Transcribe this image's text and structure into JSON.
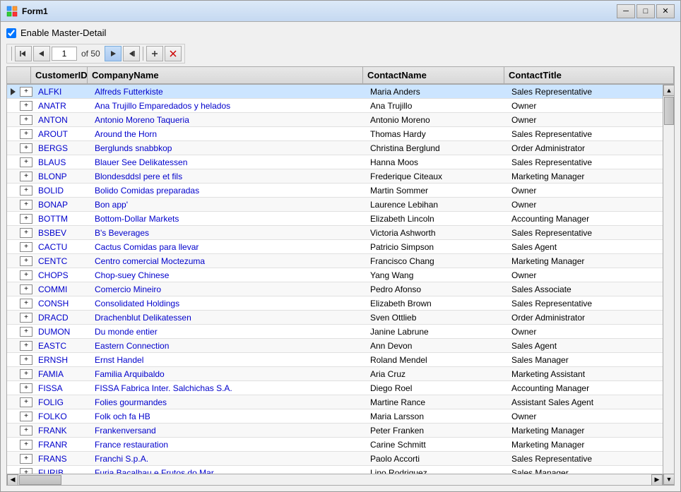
{
  "window": {
    "title": "Form1",
    "icon": "⊞"
  },
  "titlebar": {
    "minimize": "─",
    "maximize": "□",
    "close": "✕"
  },
  "toolbar": {
    "checkbox_label": "Enable Master-Detail",
    "current_page": "1",
    "of_label": "of 50",
    "btn_first": "◀◀",
    "btn_prev": "◀",
    "btn_next": "▶",
    "btn_last": "▶▶",
    "btn_add": "+",
    "btn_delete": "✕"
  },
  "grid": {
    "columns": [
      "CustomerID",
      "CompanyName",
      "ContactName",
      "ContactTitle"
    ],
    "rows": [
      {
        "id": "ALFKI",
        "company": "Alfreds Futterkiste",
        "contact": "Maria Anders",
        "title": "Sales Representative",
        "selected": true
      },
      {
        "id": "ANATR",
        "company": "Ana Trujillo Emparedados y helados",
        "contact": "Ana Trujillo",
        "title": "Owner"
      },
      {
        "id": "ANTON",
        "company": "Antonio Moreno Taqueria",
        "contact": "Antonio Moreno",
        "title": "Owner"
      },
      {
        "id": "AROUT",
        "company": "Around the Horn",
        "contact": "Thomas Hardy",
        "title": "Sales Representative"
      },
      {
        "id": "BERGS",
        "company": "Berglunds snabbkop",
        "contact": "Christina Berglund",
        "title": "Order Administrator"
      },
      {
        "id": "BLAUS",
        "company": "Blauer See Delikatessen",
        "contact": "Hanna Moos",
        "title": "Sales Representative"
      },
      {
        "id": "BLONP",
        "company": "Blondesddsl pere et fils",
        "contact": "Frederique Citeaux",
        "title": "Marketing Manager"
      },
      {
        "id": "BOLID",
        "company": "Bolido Comidas preparadas",
        "contact": "Martin Sommer",
        "title": "Owner"
      },
      {
        "id": "BONAP",
        "company": "Bon app'",
        "contact": "Laurence Lebihan",
        "title": "Owner"
      },
      {
        "id": "BOTTM",
        "company": "Bottom-Dollar Markets",
        "contact": "Elizabeth Lincoln",
        "title": "Accounting Manager"
      },
      {
        "id": "BSBEV",
        "company": "B's Beverages",
        "contact": "Victoria Ashworth",
        "title": "Sales Representative"
      },
      {
        "id": "CACTU",
        "company": "Cactus Comidas para llevar",
        "contact": "Patricio Simpson",
        "title": "Sales Agent"
      },
      {
        "id": "CENTC",
        "company": "Centro comercial Moctezuma",
        "contact": "Francisco Chang",
        "title": "Marketing Manager"
      },
      {
        "id": "CHOPS",
        "company": "Chop-suey Chinese",
        "contact": "Yang Wang",
        "title": "Owner"
      },
      {
        "id": "COMMI",
        "company": "Comercio Mineiro",
        "contact": "Pedro Afonso",
        "title": "Sales Associate"
      },
      {
        "id": "CONSH",
        "company": "Consolidated Holdings",
        "contact": "Elizabeth Brown",
        "title": "Sales Representative"
      },
      {
        "id": "DRACD",
        "company": "Drachenblut Delikatessen",
        "contact": "Sven Ottlieb",
        "title": "Order Administrator"
      },
      {
        "id": "DUMON",
        "company": "Du monde entier",
        "contact": "Janine Labrune",
        "title": "Owner"
      },
      {
        "id": "EASTC",
        "company": "Eastern Connection",
        "contact": "Ann Devon",
        "title": "Sales Agent"
      },
      {
        "id": "ERNSH",
        "company": "Ernst Handel",
        "contact": "Roland Mendel",
        "title": "Sales Manager"
      },
      {
        "id": "FAMIA",
        "company": "Familia Arquibaldo",
        "contact": "Aria Cruz",
        "title": "Marketing Assistant"
      },
      {
        "id": "FISSA",
        "company": "FISSA Fabrica Inter. Salchichas S.A.",
        "contact": "Diego Roel",
        "title": "Accounting Manager"
      },
      {
        "id": "FOLIG",
        "company": "Folies gourmandes",
        "contact": "Martine Rance",
        "title": "Assistant Sales Agent"
      },
      {
        "id": "FOLKO",
        "company": "Folk och fa HB",
        "contact": "Maria Larsson",
        "title": "Owner"
      },
      {
        "id": "FRANK",
        "company": "Frankenversand",
        "contact": "Peter Franken",
        "title": "Marketing Manager"
      },
      {
        "id": "FRANR",
        "company": "France restauration",
        "contact": "Carine Schmitt",
        "title": "Marketing Manager"
      },
      {
        "id": "FRANS",
        "company": "Franchi S.p.A.",
        "contact": "Paolo Accorti",
        "title": "Sales Representative"
      },
      {
        "id": "FURIB",
        "company": "Furia Bacalhau e Frutos do Mar",
        "contact": "Lino Rodriguez",
        "title": "Sales Manager"
      }
    ]
  }
}
